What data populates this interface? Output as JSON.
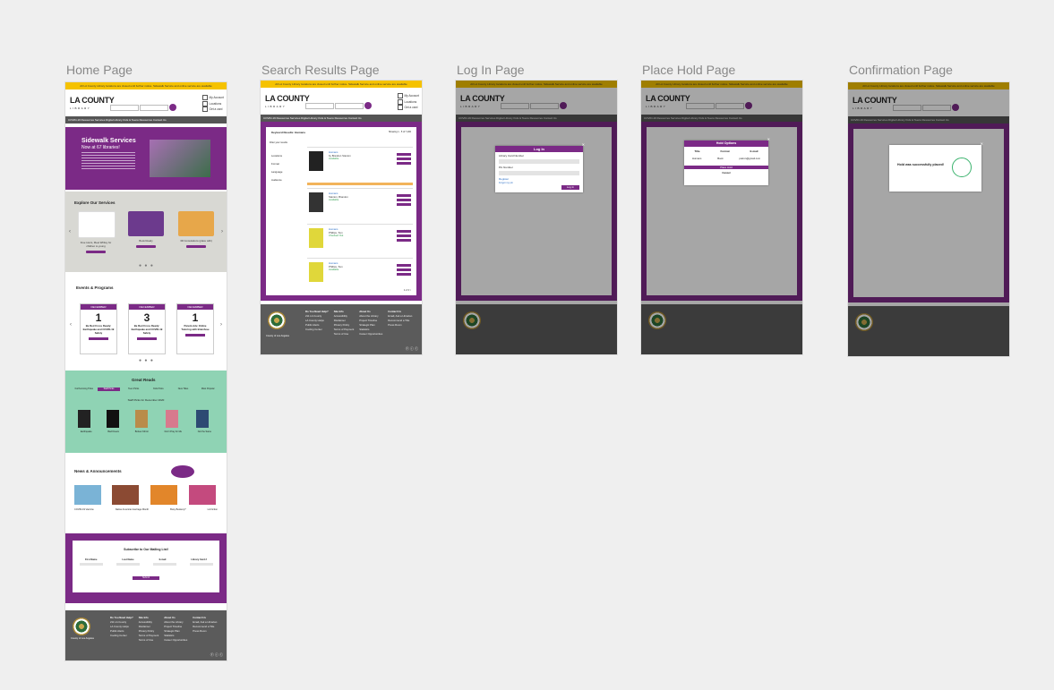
{
  "page_labels": {
    "home": "Home Page",
    "search": "Search Results Page",
    "login": "Log In Page",
    "hold": "Place Hold Page",
    "confirm": "Confirmation Page"
  },
  "common": {
    "banner": "All LA County Library locations are closed until further notice. Sidewalk Service and online service are available",
    "logo": "LA COUNTY",
    "logo_sub": "LIBRARY",
    "account_links": [
      "My Account",
      "Locations",
      "Get a card"
    ],
    "nav": "COVID-19 Resources   Services   Digital Library   Kids & Teens   Resources   Contact Us",
    "footer": {
      "seal_caption": "County of Los Angeles",
      "cols": [
        {
          "head": "Do You Need Help?",
          "items": [
            "211 LA County",
            "LA County Helps",
            "Public Alerts",
            "Cooling Center"
          ]
        },
        {
          "head": "Site Info",
          "items": [
            "Accessibility",
            "Disclaimer",
            "Privacy Policy",
            "Terms of Payment",
            "Terms of Use"
          ]
        },
        {
          "head": "About Us",
          "items": [
            "About the Library",
            "Project Timeline",
            "Strategic Plan",
            "Statistics",
            "Career Opportunities"
          ]
        },
        {
          "head": "Contact Us",
          "items": [
            "Email, Ask a Librarian",
            "Recommend a Title",
            "Press Room"
          ]
        }
      ]
    }
  },
  "home": {
    "hero_title": "Sidewalk Services",
    "hero_sub": "Now at 67 libraries!",
    "services_title": "Explore Our Services",
    "services": [
      "Free tutors, Meet Whiley for children to young",
      "Book Ready",
      "3D Consolations (place with)"
    ],
    "learn_more": "Learn More",
    "events_title": "Events & Programs",
    "events": [
      {
        "month": "DECEMBER",
        "day": "1",
        "title": "Be Red Cross Ready: Earthquake and COVID-19 Safety"
      },
      {
        "month": "DECEMBER",
        "day": "3",
        "title": "Be Red Cross Ready: Earthquake and COVID-19 Safety"
      },
      {
        "month": "DECEMBER",
        "day": "1",
        "title": "Parent-Adv. Online Tutoring with Brainfuse"
      }
    ],
    "great_reads_title": "Great Reads",
    "great_reads_sub": "Staff Picks for December 2020",
    "tabs": [
      "Forthcoming Titles",
      "Staff Picks",
      "Teen Picks",
      "Kids Picks",
      "New Titles",
      "Most Popular"
    ],
    "books": [
      "Earthquake",
      "Bad Dream",
      "Broken Mirror",
      "Don't Pray for Me",
      "Not the Same"
    ],
    "news_title": "News & Announcements",
    "news": [
      "COVID-19 Vaccine",
      "Native American Heritage Month",
      "Busy Bookery?",
      "LA Fiction"
    ],
    "subscribe_title": "Subscribe to Our Mailing List!",
    "sub_fields": [
      "First Name",
      "Last Name",
      "E-mail",
      "Library Card #"
    ],
    "sub_button": "Submit"
  },
  "search": {
    "header": "Keyword Results: Humans",
    "results_label": "Showing 1 - 5 of 7,200",
    "filter": "Filter your results",
    "facets": [
      "Locations",
      "Format",
      "Language",
      "Audience"
    ],
    "items": [
      {
        "title": "Humans",
        "author": "by Brandon Stanton",
        "status": "Available"
      },
      {
        "title": "Humans",
        "author": "Stanton, Brandon",
        "status": "Available"
      },
      {
        "title": "Humans",
        "author": "Phillips, Tom",
        "status": "Checked Out"
      },
      {
        "title": "Humans",
        "author": "Phillips, Tom",
        "status": "Available"
      }
    ],
    "btn_labels": [
      "Place Hold",
      "Add to List",
      "More Info"
    ],
    "pager": "1 2 3 >"
  },
  "login": {
    "title": "Log In",
    "card_label": "Library Card Number",
    "pin_label": "Pin Number",
    "register": "Register",
    "forgot": "Forgot my pin",
    "button": "Log In"
  },
  "hold": {
    "title": "Hold Options",
    "cols": [
      "Title",
      "Format",
      "E-mail"
    ],
    "values": [
      "Humans",
      "Book",
      "patron@gmail.com"
    ],
    "place": "Place Hold",
    "cancel": "Cancel"
  },
  "confirm": {
    "message": "Hold was successfully placed!"
  },
  "colors": {
    "purple": "#7b2a86",
    "yellow": "#f5c200",
    "green": "#8fd3b4",
    "footer": "#5b5b5b"
  }
}
